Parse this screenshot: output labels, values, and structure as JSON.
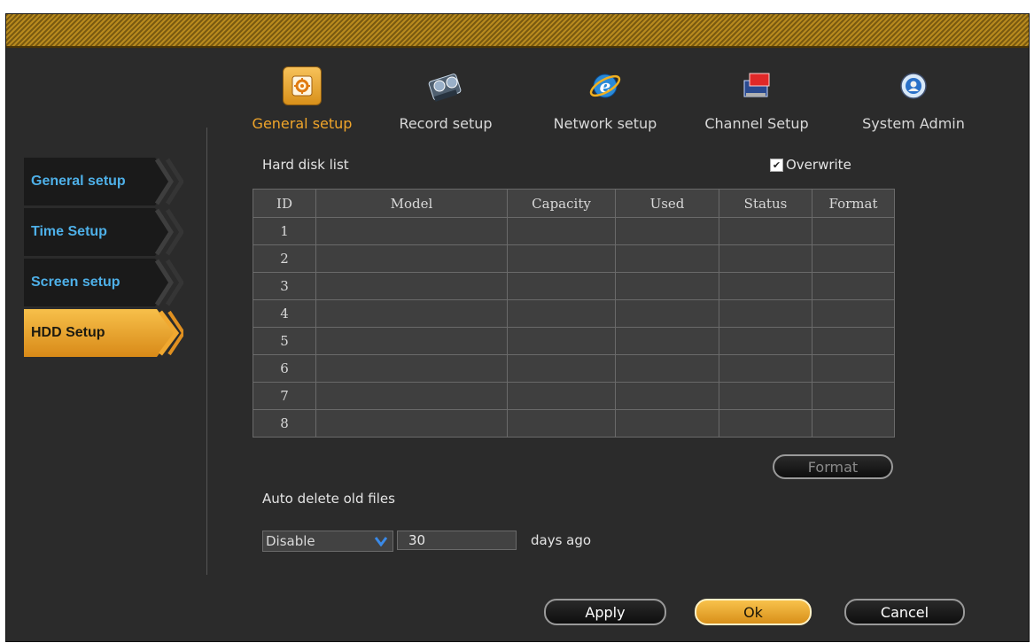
{
  "topnav": {
    "items": [
      {
        "label": "General setup",
        "icon": "settings-icon"
      },
      {
        "label": "Record setup",
        "icon": "film-icon"
      },
      {
        "label": "Network setup",
        "icon": "browser-icon"
      },
      {
        "label": "Channel Setup",
        "icon": "channel-icon"
      },
      {
        "label": "System Admin",
        "icon": "admin-icon"
      }
    ],
    "active_index": 0
  },
  "sidebar": {
    "items": [
      {
        "label": "General setup"
      },
      {
        "label": "Time Setup"
      },
      {
        "label": "Screen setup"
      },
      {
        "label": "HDD Setup"
      }
    ],
    "active_index": 3
  },
  "hdd": {
    "list_title": "Hard disk list",
    "overwrite_label": "Overwrite",
    "overwrite_checked": true,
    "table": {
      "headers": [
        "ID",
        "Model",
        "Capacity",
        "Used",
        "Status",
        "Format"
      ],
      "rows": [
        [
          "1",
          "",
          "",
          "",
          "",
          ""
        ],
        [
          "2",
          "",
          "",
          "",
          "",
          ""
        ],
        [
          "3",
          "",
          "",
          "",
          "",
          ""
        ],
        [
          "4",
          "",
          "",
          "",
          "",
          ""
        ],
        [
          "5",
          "",
          "",
          "",
          "",
          ""
        ],
        [
          "6",
          "",
          "",
          "",
          "",
          ""
        ],
        [
          "7",
          "",
          "",
          "",
          "",
          ""
        ],
        [
          "8",
          "",
          "",
          "",
          "",
          ""
        ]
      ]
    },
    "format_button": "Format",
    "auto_delete_label": "Auto delete old files",
    "auto_delete_select": "Disable",
    "days_value": "30",
    "days_suffix": "days ago"
  },
  "buttons": {
    "apply": "Apply",
    "ok": "Ok",
    "cancel": "Cancel"
  },
  "colors": {
    "accent": "#f0a52a",
    "sidebar_text": "#4eb0e8",
    "background": "#2b2b2b"
  }
}
